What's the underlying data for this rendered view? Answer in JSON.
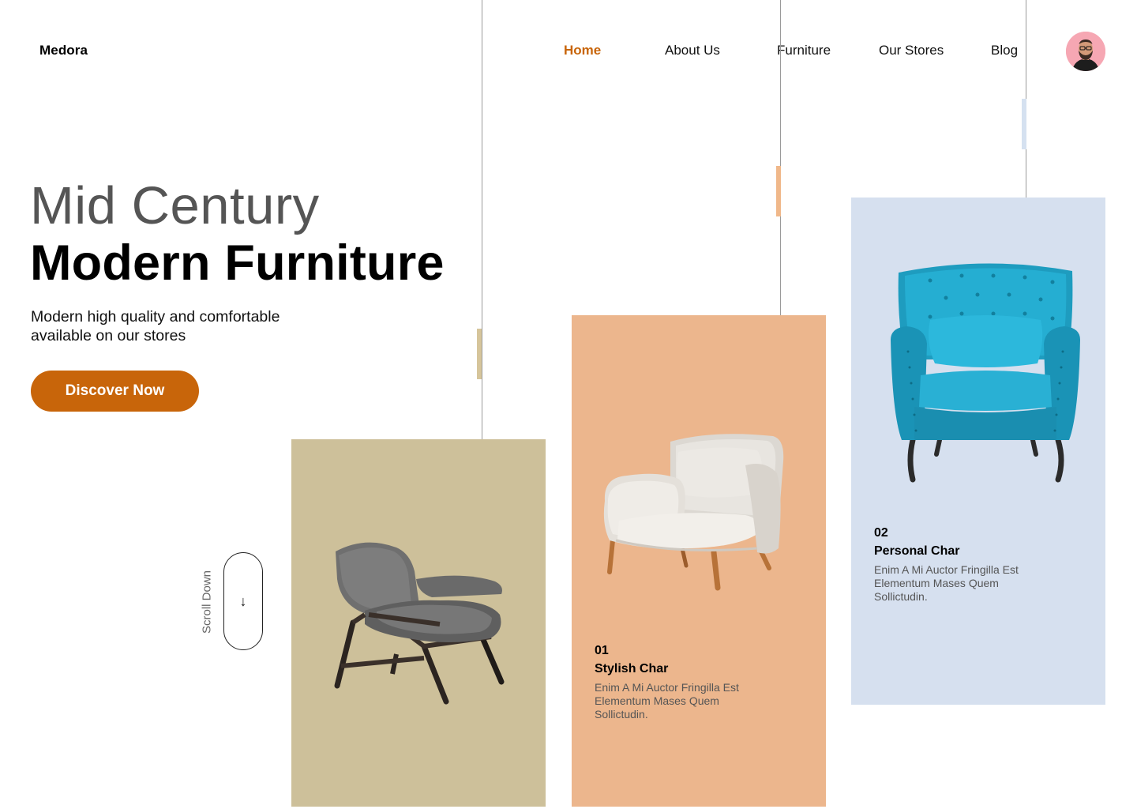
{
  "brand": {
    "name": "Medora"
  },
  "nav": {
    "items": [
      {
        "label": "Home",
        "active": true
      },
      {
        "label": "About Us",
        "active": false
      },
      {
        "label": "Furniture",
        "active": false
      },
      {
        "label": "Our Stores",
        "active": false
      },
      {
        "label": "Blog",
        "active": false
      }
    ],
    "active_color": "#c8650a"
  },
  "hero": {
    "title_line1": "Mid Century",
    "title_line2": "Modern Furniture",
    "subtitle_line1": "Modern high quality and comfortable",
    "subtitle_line2": "available on our stores",
    "cta_label": "Discover Now",
    "accent_color": "#c8650a"
  },
  "scroll": {
    "label": "Scroll Down",
    "icon": "↓"
  },
  "products": [
    {
      "number": "",
      "name": "",
      "description": "",
      "bg_color": "#cdc09a",
      "image": "grey-lounge-chair-icon"
    },
    {
      "number": "01",
      "name": "Stylish Char",
      "description": "Enim A Mi Auctor Fringilla Est Elementum Mases Quem Sollictudin.",
      "bg_color": "#ecb68d",
      "image": "white-armchair-icon"
    },
    {
      "number": "02",
      "name": "Personal Char",
      "description": "Enim A Mi Auctor Fringilla Est Elementum Mases Quem Sollictudin.",
      "bg_color": "#d6e0ef",
      "image": "teal-tufted-armchair-icon"
    }
  ],
  "user": {
    "avatar": "user-avatar-icon"
  }
}
